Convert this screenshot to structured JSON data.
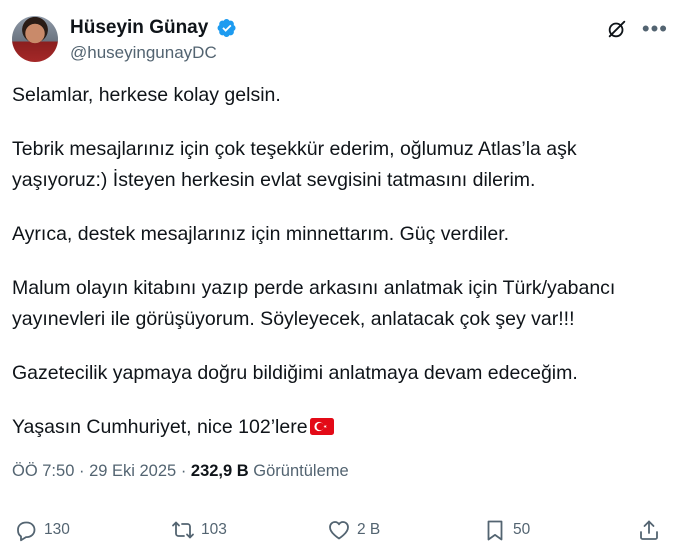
{
  "author": {
    "display_name": "Hüseyin Günay",
    "handle": "@huseyingunayDC",
    "verified": true,
    "badge_color": "#1d9bf0"
  },
  "header_icons": [
    "grok-icon",
    "more-icon"
  ],
  "tweet": {
    "paragraphs": [
      "Selamlar, herkese kolay gelsin.",
      "Tebrik mesajlarınız için çok teşekkür ederim, oğlumuz Atlas’la aşk yaşıyoruz:) İsteyen herkesin evlat sevgisini tatmasını dilerim.",
      "Ayrıca, destek mesajlarınız için minnettarım. Güç verdiler.",
      "Malum olayın kitabını yazıp perde arkasını anlatmak için Türk/yabancı yayınevleri ile görüşüyorum. Söyleyecek, anlatacak çok şey var!!!",
      "Gazetecilik yapmaya doğru bildiğimi anlatmaya devam edeceğim.",
      "Yaşasın Cumhuriyet, nice 102’lere"
    ],
    "emoji": "turkey-flag"
  },
  "meta": {
    "time": "ÖÖ 7:50",
    "separator": "·",
    "date": "29 Eki 2025",
    "views_count": "232,9 B",
    "views_label": "Görüntüleme"
  },
  "actions": {
    "reply_count": "130",
    "repost_count": "103",
    "like_count": "2 B",
    "bookmark_count": "50"
  },
  "colors": {
    "text": "#0f1419",
    "secondary": "#536471",
    "verified": "#1d9bf0",
    "flag_red": "#e30a17"
  }
}
